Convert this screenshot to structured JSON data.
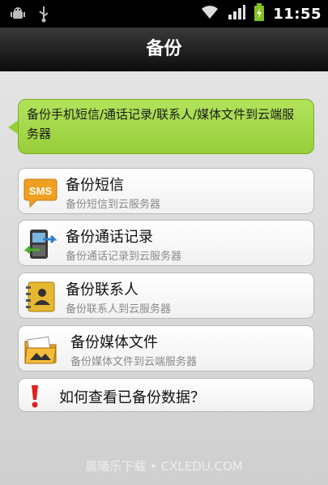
{
  "status_bar": {
    "time": "11:55"
  },
  "header": {
    "title": "备份"
  },
  "banner": {
    "text": "备份手机短信/通话记录/联系人/媒体文件到云端服务器"
  },
  "items": [
    {
      "title": "备份短信",
      "subtitle": "备份短信到云服务器",
      "icon": "sms-icon",
      "icon_text": "SMS"
    },
    {
      "title": "备份通话记录",
      "subtitle": "备份通话记录到云服务器",
      "icon": "phone-icon"
    },
    {
      "title": "备份联系人",
      "subtitle": "备份联系人到云服务器",
      "icon": "contacts-icon"
    },
    {
      "title": "备份媒体文件",
      "subtitle": "备份媒体文件到云端服务器",
      "icon": "media-folder-icon"
    }
  ],
  "help": {
    "label": "如何查看已备份数据？",
    "icon": "exclamation-icon"
  },
  "watermark": "晨曦乐下载 • CXLEDU.COM",
  "colors": {
    "accent_green": "#97ce3a",
    "sms_orange": "#f0a020",
    "alert_red": "#e02020"
  }
}
